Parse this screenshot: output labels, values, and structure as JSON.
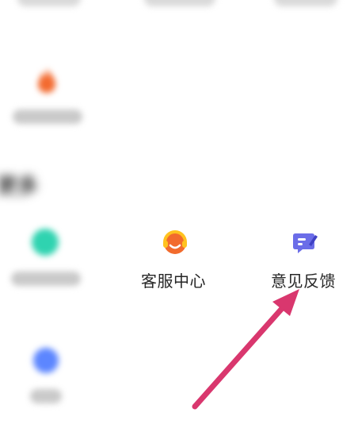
{
  "more_section": {
    "title": "更多",
    "items": [
      {
        "label": "客服中心",
        "icon": "headset-icon"
      },
      {
        "label": "意见反馈",
        "icon": "feedback-edit-icon"
      }
    ]
  },
  "colors": {
    "accent_arrow": "#d9376e",
    "headset_orange": "#f26b2d",
    "headset_yellow": "#ffc21f",
    "feedback_purple": "#6b6de8",
    "flame_orange": "#f36a2f",
    "teal": "#2fd3b0",
    "blue": "#5c86ff"
  }
}
